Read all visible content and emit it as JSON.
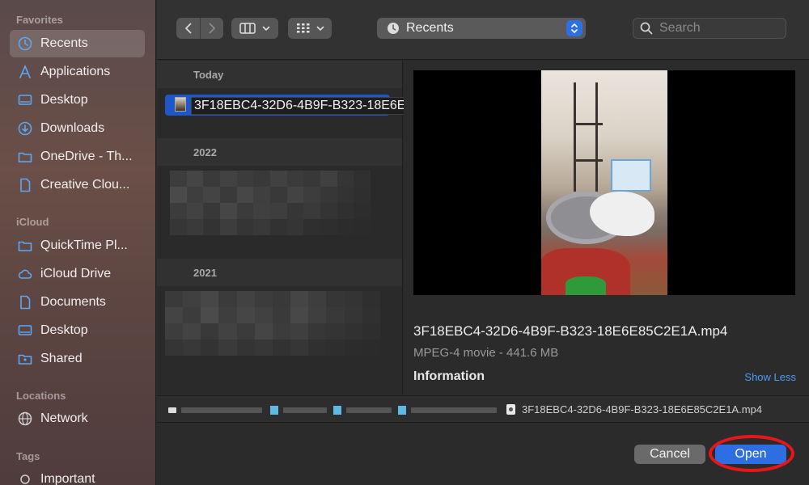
{
  "sidebar": {
    "sections": {
      "favorites": "Favorites",
      "icloud": "iCloud",
      "locations": "Locations",
      "tags": "Tags"
    },
    "favorites": [
      {
        "label": "Recents",
        "icon": "clock-icon",
        "selected": true
      },
      {
        "label": "Applications",
        "icon": "applications-icon"
      },
      {
        "label": "Desktop",
        "icon": "desktop-icon"
      },
      {
        "label": "Downloads",
        "icon": "download-icon"
      },
      {
        "label": "OneDrive - Th...",
        "icon": "folder-icon"
      },
      {
        "label": "Creative Clou...",
        "icon": "document-icon"
      }
    ],
    "icloud": [
      {
        "label": "QuickTime Pl...",
        "icon": "folder-icon"
      },
      {
        "label": "iCloud Drive",
        "icon": "cloud-icon"
      },
      {
        "label": "Documents",
        "icon": "document-icon"
      },
      {
        "label": "Desktop",
        "icon": "desktop-icon"
      },
      {
        "label": "Shared",
        "icon": "shared-folder-icon"
      }
    ],
    "locations": [
      {
        "label": "Network",
        "icon": "globe-icon"
      }
    ],
    "tags": [
      {
        "label": "Important",
        "icon": "tag-circle-icon"
      }
    ]
  },
  "toolbar": {
    "location": "Recents",
    "search_placeholder": "Search"
  },
  "filelist": {
    "groups": [
      "Today",
      "2022",
      "2021"
    ],
    "selected_file": "3F18EBC4-32D6-4B9F-B323-18E6E85C2E1A.mp4"
  },
  "preview": {
    "filename": "3F18EBC4-32D6-4B9F-B323-18E6E85C2E1A.mp4",
    "meta": "MPEG-4 movie - 441.6 MB",
    "info_heading": "Information",
    "show_less": "Show Less"
  },
  "pathbar": {
    "file": "3F18EBC4-32D6-4B9F-B323-18E6E85C2E1A.mp4"
  },
  "buttons": {
    "cancel": "Cancel",
    "open": "Open"
  },
  "colors": {
    "accent": "#2d6fe2",
    "selection": "#1f57c7",
    "highlight_ring": "#e8161b",
    "link": "#4a9cf2"
  }
}
